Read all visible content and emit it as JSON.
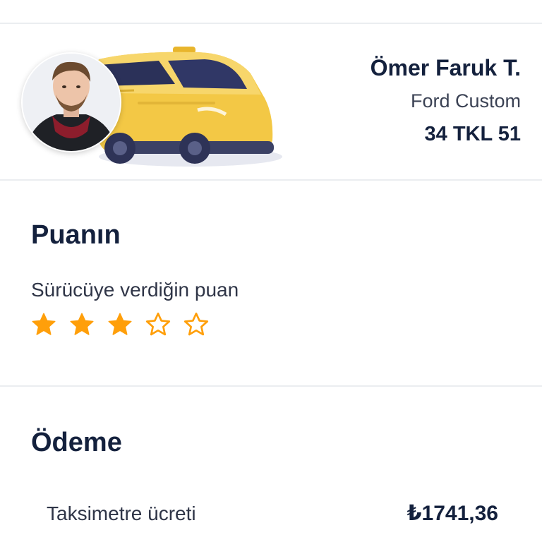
{
  "driver": {
    "name": "Ömer Faruk T.",
    "car_model": "Ford Custom",
    "plate": "34 TKL 51"
  },
  "rating": {
    "title": "Puanın",
    "subtitle": "Sürücüye verdiğin puan",
    "value": 3,
    "max": 5,
    "star_color": "#ff9f0a"
  },
  "payment": {
    "title": "Ödeme",
    "fare_label": "Taksimetre ücreti",
    "fare_value": "₺1741,36"
  },
  "colors": {
    "text_primary": "#14213d",
    "divider": "#ebedf0",
    "taxi_yellow": "#f3c845"
  },
  "icons": {
    "avatar": "driver-avatar",
    "vehicle": "taxi-car-illustration",
    "star_filled": "star-filled-icon",
    "star_empty": "star-outline-icon"
  }
}
